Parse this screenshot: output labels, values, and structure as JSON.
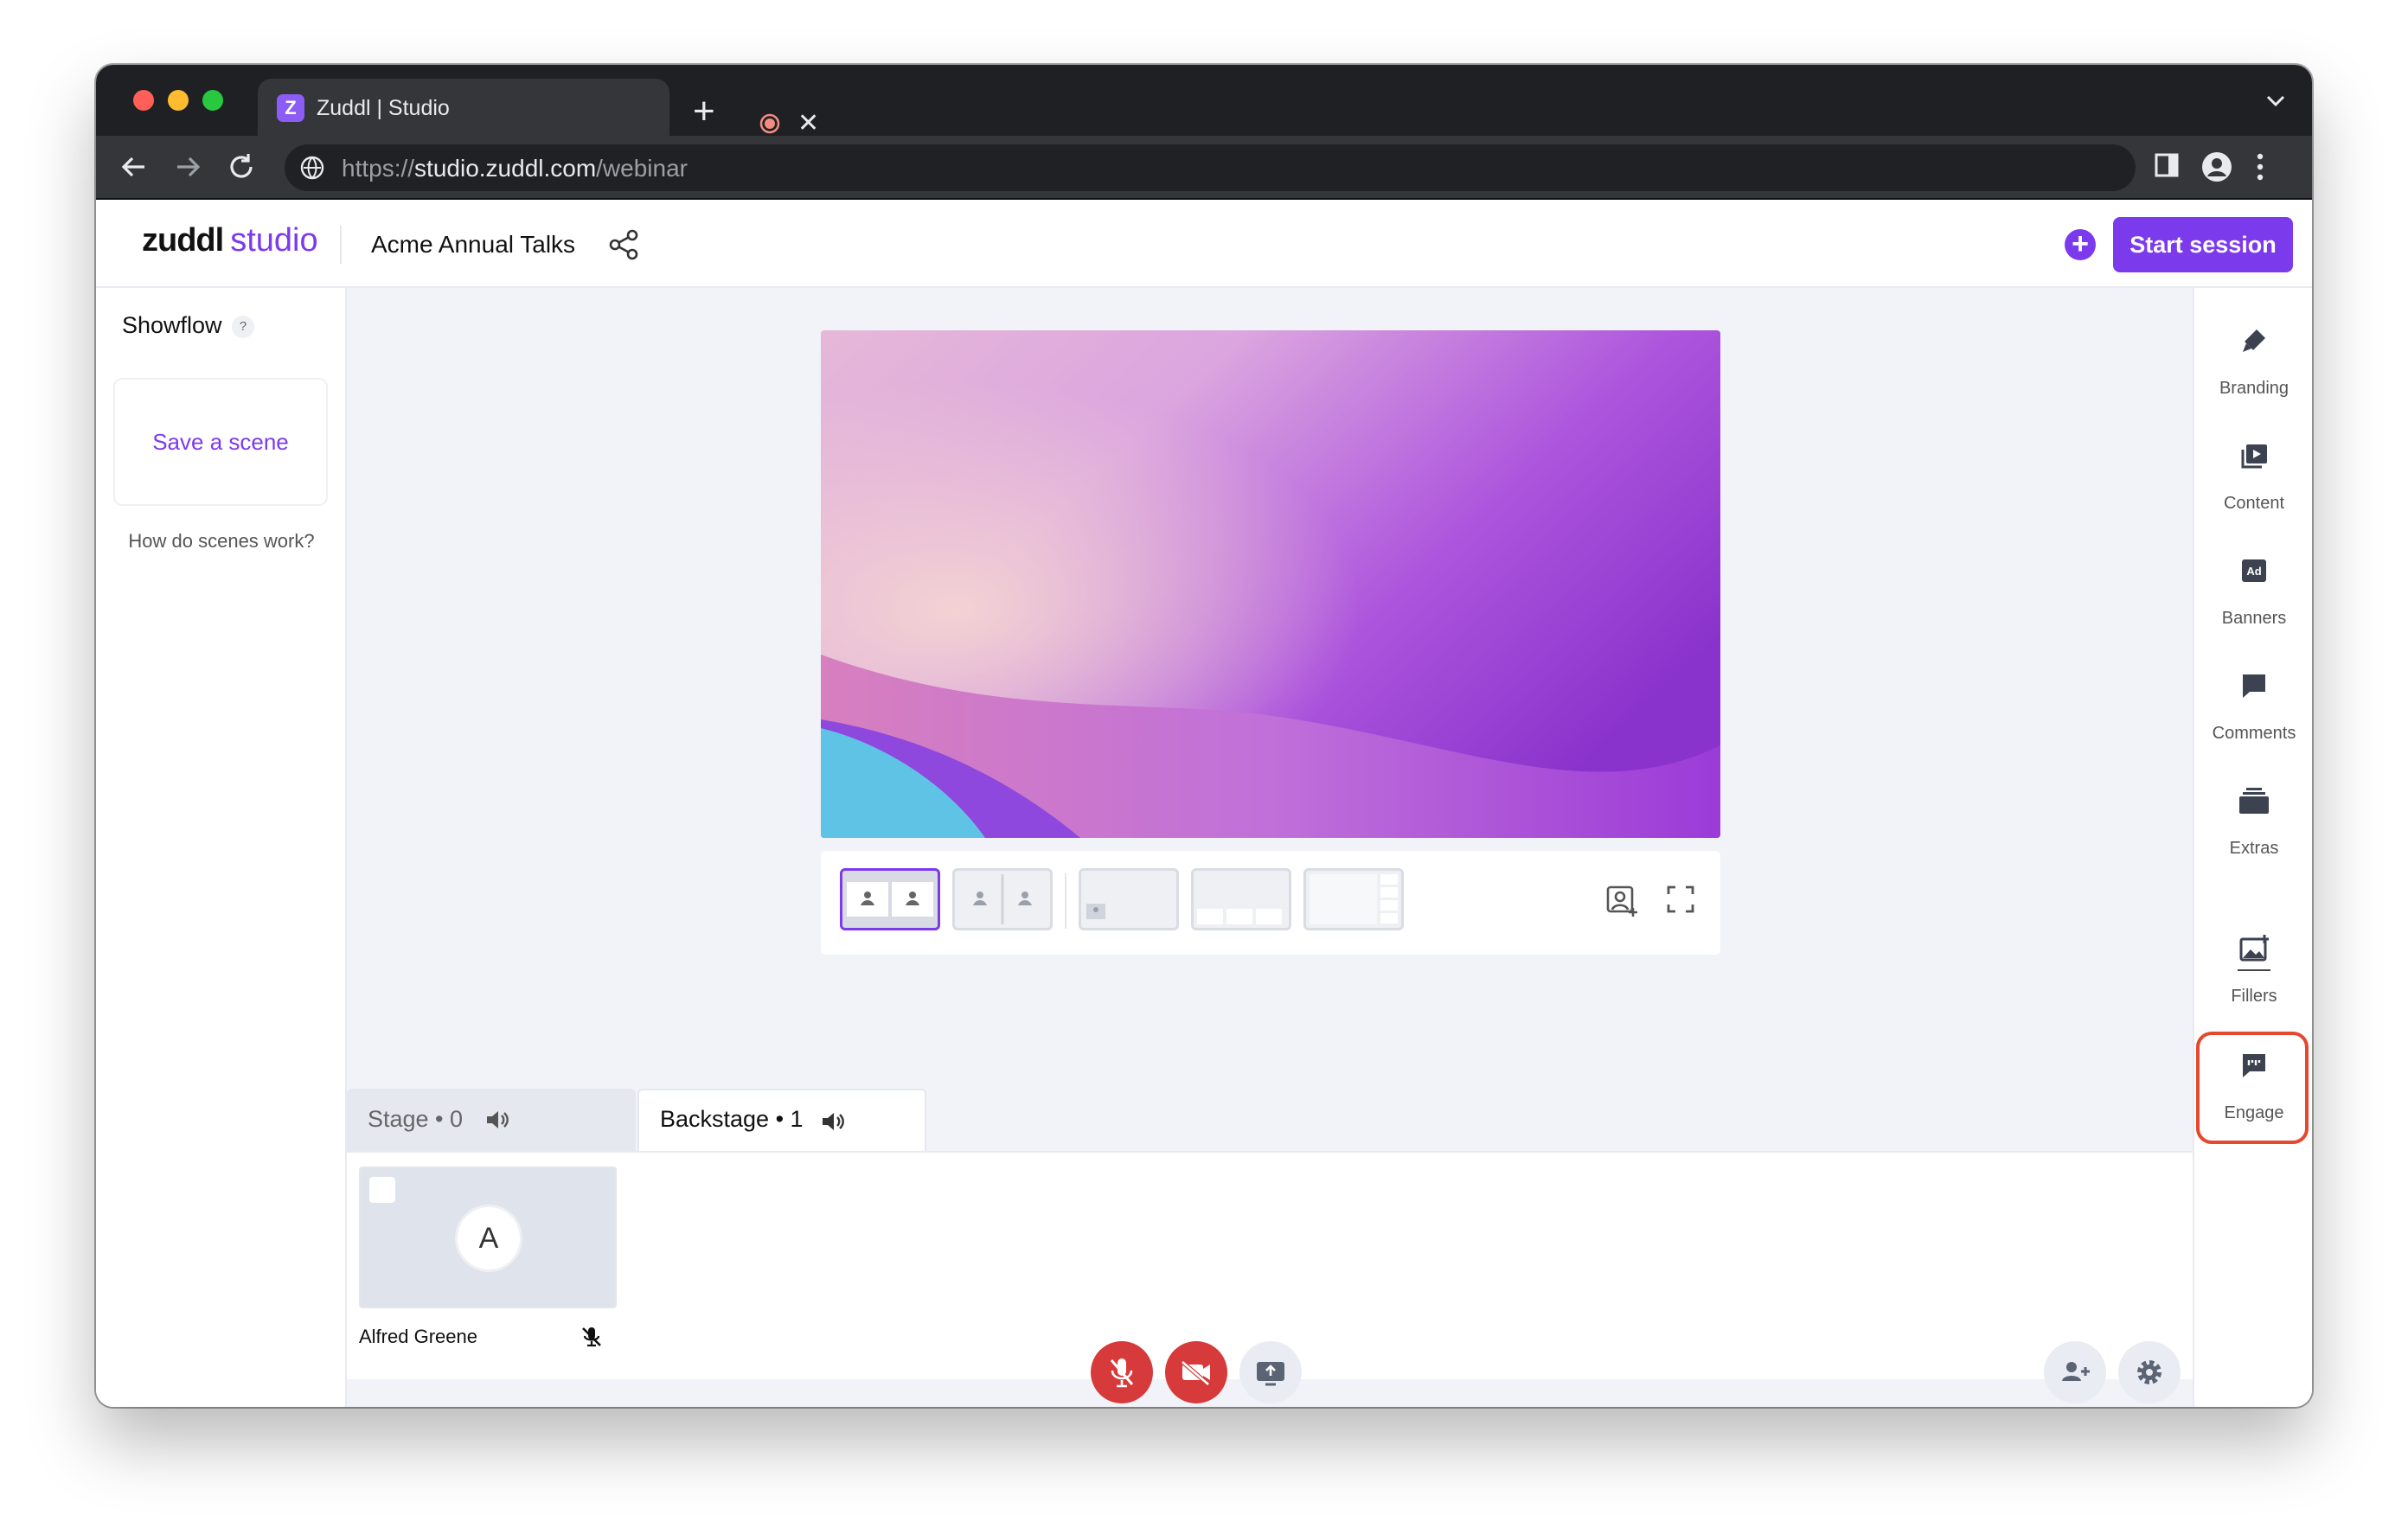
{
  "browser": {
    "tab_title": "Zuddl | Studio",
    "tab_favicon_letter": "Z",
    "url_scheme": "https://",
    "url_host": "studio.zuddl.com",
    "url_path": "/webinar"
  },
  "header": {
    "logo_bold": "zuddl",
    "logo_light": "studio",
    "event_title": "Acme Annual Talks",
    "start_button": "Start session",
    "accent_color": "#7c3aed"
  },
  "left_panel": {
    "title": "Showflow",
    "help": "?",
    "save_scene": "Save a scene",
    "how_link": "How do scenes work?"
  },
  "tabs": {
    "stage": "Stage • 0",
    "backstage": "Backstage • 1"
  },
  "participants": [
    {
      "initial": "A",
      "name": "Alfred Greene"
    }
  ],
  "right_panel": {
    "items": [
      {
        "label": "Branding",
        "icon": "brush-icon"
      },
      {
        "label": "Content",
        "icon": "media-icon"
      },
      {
        "label": "Banners",
        "icon": "ad-icon"
      },
      {
        "label": "Comments",
        "icon": "comment-icon"
      },
      {
        "label": "Extras",
        "icon": "layers-icon"
      },
      {
        "label": "Fillers",
        "icon": "image-icon"
      },
      {
        "label": "Engage",
        "icon": "quote-icon"
      }
    ],
    "highlight_color": "#e5482f"
  },
  "ad_icon_text": "Ad"
}
